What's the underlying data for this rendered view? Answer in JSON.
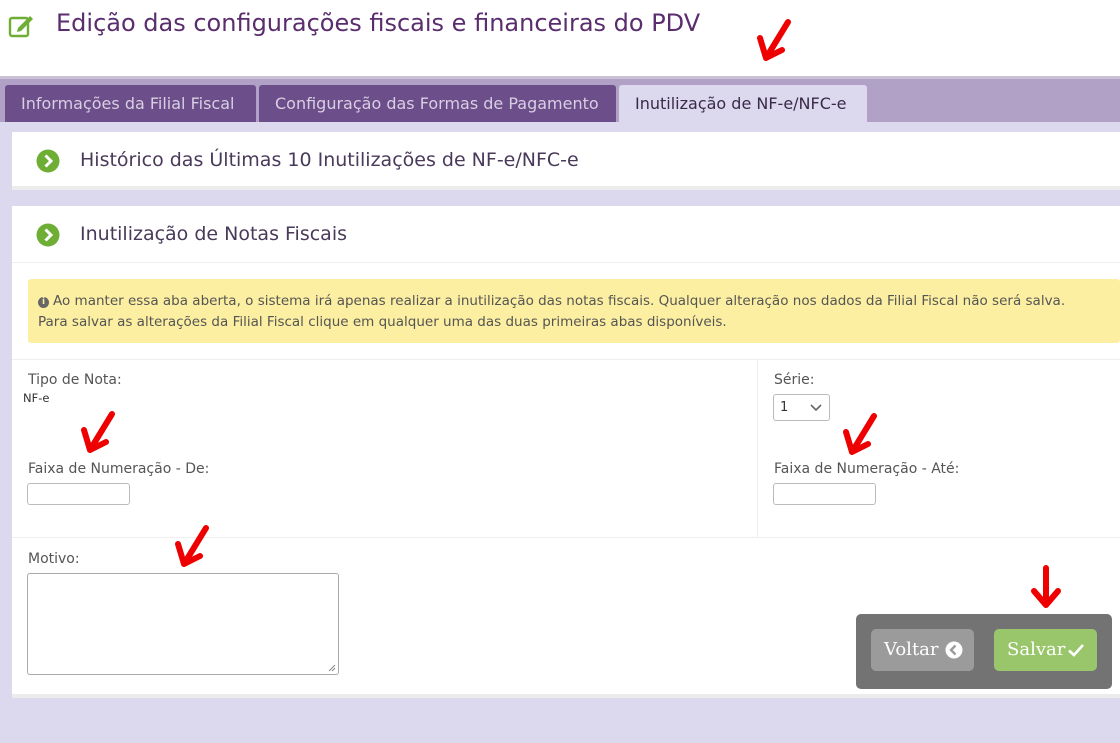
{
  "header": {
    "title": "Edição das configurações fiscais e financeiras do PDV",
    "icon": "edit-icon"
  },
  "tabs": [
    {
      "label": "Informações da Filial Fiscal",
      "active": false
    },
    {
      "label": "Configuração das Formas de Pagamento",
      "active": false
    },
    {
      "label": "Inutilização de NF-e/NFC-e",
      "active": true
    }
  ],
  "panels": {
    "history": {
      "title": "Histórico das Últimas 10 Inutilizações de NF-e/NFC-e",
      "icon": "chevron-right-icon"
    },
    "inutilizacao": {
      "title": "Inutilização de Notas Fiscais",
      "icon": "chevron-right-icon"
    }
  },
  "alert": {
    "line1": "Ao manter essa aba aberta, o sistema irá apenas realizar a inutilização das notas fiscais. Qualquer alteração nos dados da Filial Fiscal não será salva.",
    "line2": "Para salvar as alterações da Filial Fiscal clique em qualquer uma das duas primeiras abas disponíveis.",
    "icon": "info-icon"
  },
  "form": {
    "tipo_label": "Tipo de Nota:",
    "tipo_value": "NF-e",
    "serie_label": "Série:",
    "serie_value": "1",
    "faixa_de_label": "Faixa de Numeração - De:",
    "faixa_de_value": "",
    "faixa_ate_label": "Faixa de Numeração - Até:",
    "faixa_ate_value": "",
    "motivo_label": "Motivo:",
    "motivo_value": ""
  },
  "actions": {
    "voltar_label": "Voltar",
    "salvar_label": "Salvar"
  },
  "colors": {
    "title": "#5a2d6e",
    "tab_inactive": "#6b4e8a",
    "tab_active": "#dcd8ee",
    "chevron": "#6fae35",
    "alert_bg": "#fcefa1",
    "salvar": "#9ac66b",
    "voltar": "#9b9b9b",
    "annotation_arrow": "#ee0000"
  }
}
